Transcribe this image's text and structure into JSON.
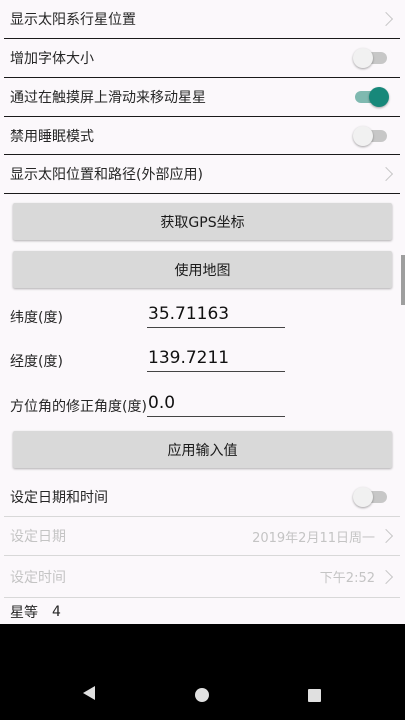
{
  "settings": {
    "show_planet_positions": "显示太阳系行星位置",
    "increase_font_size": "增加字体大小",
    "swipe_to_move_stars": "通过在触摸屏上滑动来移动星星",
    "disable_sleep_mode": "禁用睡眠模式",
    "show_sun_path_external": "显示太阳位置和路径(外部应用)"
  },
  "toggles": {
    "increase_font_size": false,
    "swipe_to_move_stars": true,
    "disable_sleep_mode": false,
    "set_datetime": false
  },
  "buttons": {
    "get_gps": "获取GPS坐标",
    "use_map": "使用地图",
    "apply_input": "应用输入值"
  },
  "fields": {
    "latitude_label": "纬度(度)",
    "latitude_value": "35.71163",
    "longitude_label": "经度(度)",
    "longitude_value": "139.7211",
    "azimuth_label": "方位角的修正角度(度)",
    "azimuth_value": "0.0"
  },
  "datetime": {
    "set_datetime_label": "设定日期和时间",
    "set_date_label": "设定日期",
    "date_value": "2019年2月11日周一",
    "set_time_label": "设定时间",
    "time_value": "下午2:52"
  },
  "magnitude": {
    "label": "星等",
    "value": "4"
  },
  "colors": {
    "accent": "#17887a",
    "background": "#fbf8fb",
    "button": "#d9d9d9"
  },
  "navigation": {
    "icons": [
      "back-icon",
      "home-icon",
      "recent-apps-icon"
    ]
  }
}
